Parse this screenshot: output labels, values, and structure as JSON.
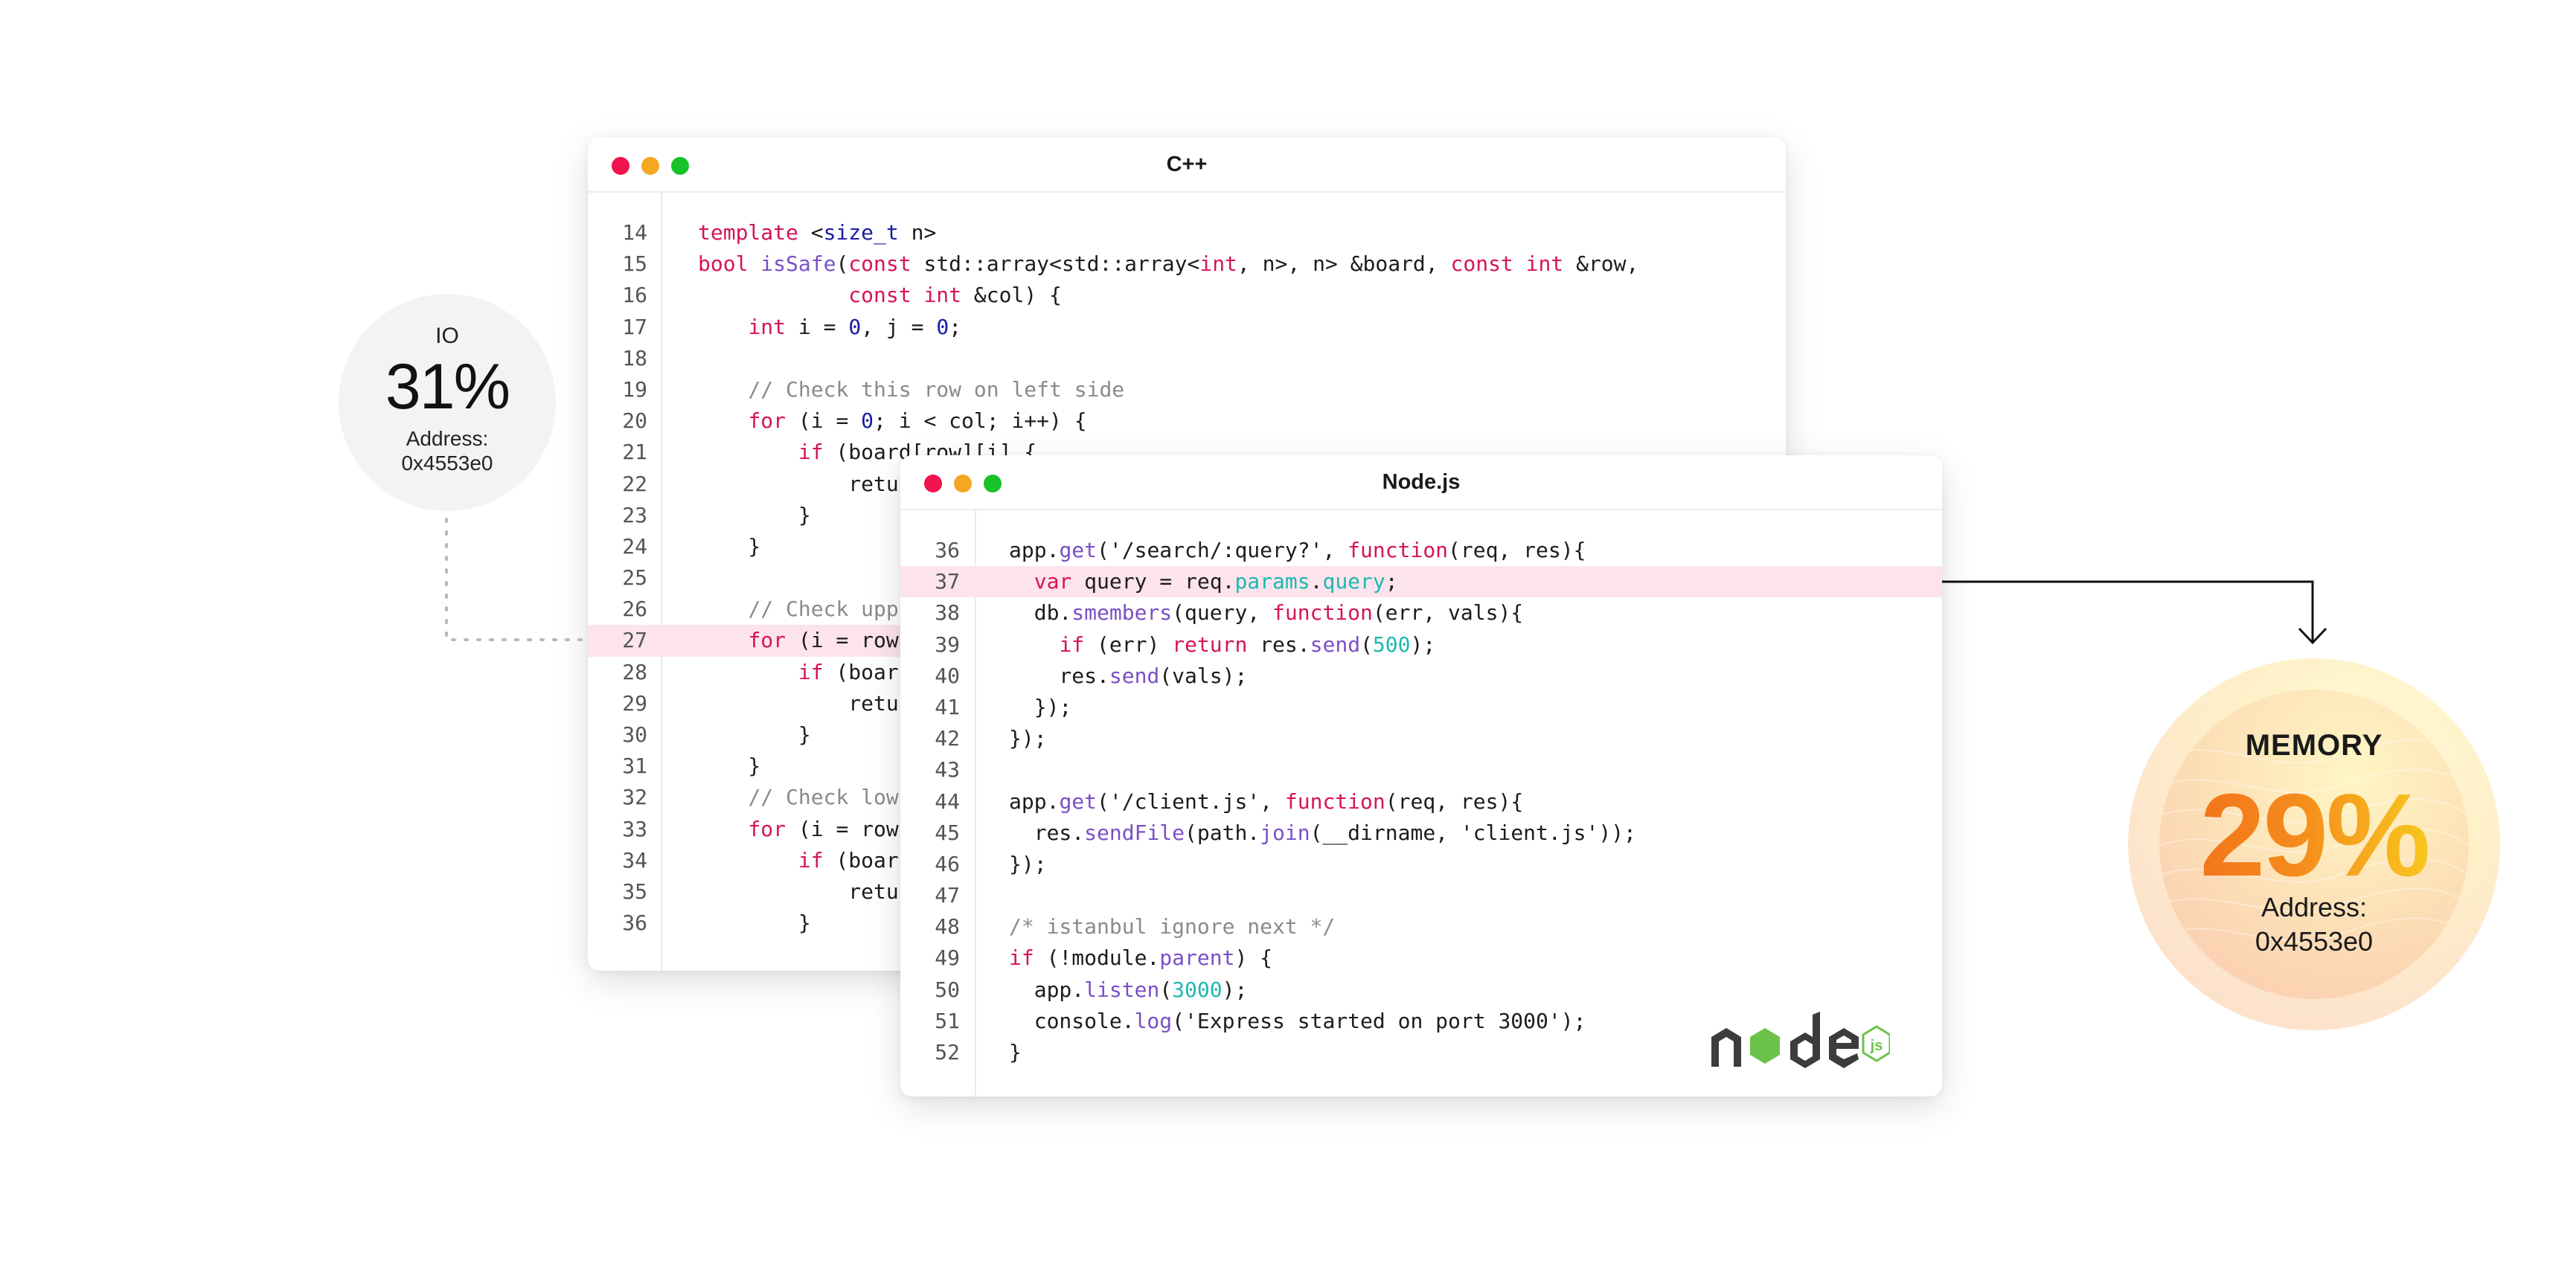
{
  "io": {
    "label": "IO",
    "value": "31%",
    "address_label": "Address:",
    "address": "0x4553e0"
  },
  "memory": {
    "label": "MEMORY",
    "value": "29%",
    "address_label": "Address:",
    "address": "0x4553e0"
  },
  "cpp_window": {
    "title": "C++",
    "lines": [
      {
        "n": "14",
        "t": "template <size_t n>"
      },
      {
        "n": "15",
        "t": "bool isSafe(const std::array<std::array<int, n>, n> &board, const int &row,"
      },
      {
        "n": "16",
        "t": "            const int &col) {"
      },
      {
        "n": "17",
        "t": "    int i = 0, j = 0;"
      },
      {
        "n": "18",
        "t": ""
      },
      {
        "n": "19",
        "t": "    // Check this row on left side"
      },
      {
        "n": "20",
        "t": "    for (i = 0; i < col; i++) {"
      },
      {
        "n": "21",
        "t": "        if (board[row][i] {"
      },
      {
        "n": "22",
        "t": "            retu"
      },
      {
        "n": "23",
        "t": "        }"
      },
      {
        "n": "24",
        "t": "    }"
      },
      {
        "n": "25",
        "t": ""
      },
      {
        "n": "26",
        "t": "    // Check upp"
      },
      {
        "n": "27",
        "t": "    for (i = row"
      },
      {
        "n": "28",
        "t": "        if (boar"
      },
      {
        "n": "29",
        "t": "            retu"
      },
      {
        "n": "30",
        "t": "        }"
      },
      {
        "n": "31",
        "t": "    }"
      },
      {
        "n": "32",
        "t": "    // Check low"
      },
      {
        "n": "33",
        "t": "    for (i = row"
      },
      {
        "n": "34",
        "t": "        if (boar"
      },
      {
        "n": "35",
        "t": "            retu"
      },
      {
        "n": "36",
        "t": "        }"
      }
    ],
    "highlight_line": "27"
  },
  "node_window": {
    "title": "Node.js",
    "lines": [
      {
        "n": "36",
        "t": "app.get('/search/:query?', function(req, res){"
      },
      {
        "n": "37",
        "t": "  var query = req.params.query;"
      },
      {
        "n": "38",
        "t": "  db.smembers(query, function(err, vals){"
      },
      {
        "n": "39",
        "t": "    if (err) return res.send(500);"
      },
      {
        "n": "40",
        "t": "    res.send(vals);"
      },
      {
        "n": "41",
        "t": "  });"
      },
      {
        "n": "42",
        "t": "});"
      },
      {
        "n": "43",
        "t": ""
      },
      {
        "n": "44",
        "t": "app.get('/client.js', function(req, res){"
      },
      {
        "n": "45",
        "t": "  res.sendFile(path.join(__dirname, 'client.js'));"
      },
      {
        "n": "46",
        "t": "});"
      },
      {
        "n": "47",
        "t": ""
      },
      {
        "n": "48",
        "t": "/* istanbul ignore next */"
      },
      {
        "n": "49",
        "t": "if (!module.parent) {"
      },
      {
        "n": "50",
        "t": "  app.listen(3000);"
      },
      {
        "n": "51",
        "t": "  console.log('Express started on port 3000');"
      },
      {
        "n": "52",
        "t": "}"
      }
    ],
    "highlight_line": "37",
    "logo": "nodejs-logo"
  },
  "colors": {
    "keyword": "#d6135a",
    "function": "#7a4fc7",
    "number": "#1a1aa6",
    "comment": "#8a8a8a",
    "accent": "#1cb8b0",
    "highlight": "#fde4ec",
    "dot_red": "#f0134d",
    "dot_yellow": "#f5a623",
    "dot_green": "#17c22a"
  }
}
